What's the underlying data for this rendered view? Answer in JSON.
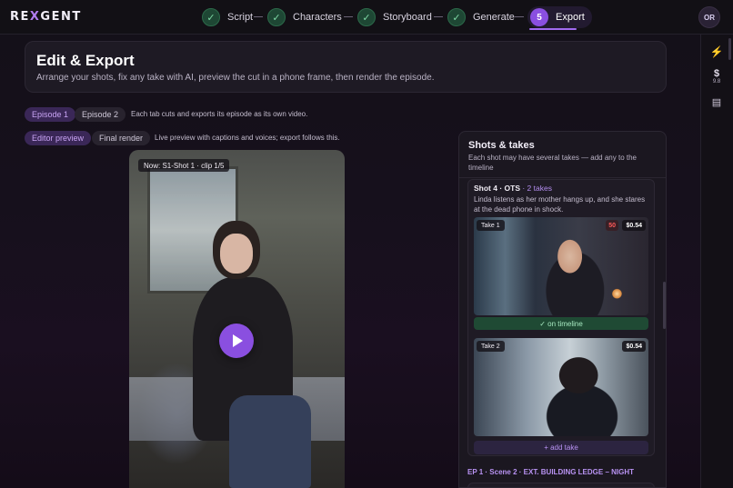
{
  "app": {
    "logo_main": "RE",
    "logo_x": "X",
    "logo_rest": "GENT"
  },
  "steps": [
    {
      "label": "Script",
      "done": true
    },
    {
      "label": "Characters",
      "done": true
    },
    {
      "label": "Storyboard",
      "done": true
    },
    {
      "label": "Generate",
      "done": true
    },
    {
      "label": "Export",
      "number": "5",
      "active": true
    }
  ],
  "user": {
    "initials": "OR"
  },
  "rail": {
    "dollar": "$",
    "credits": "9.8"
  },
  "header": {
    "title": "Edit & Export",
    "subtitle": "Arrange your shots, fix any take with AI, preview the cut in a phone frame, then render the episode."
  },
  "episodes": {
    "tabs": [
      "Episode 1",
      "Episode 2"
    ],
    "active": "Episode 1",
    "hint": "Each tab cuts and exports its episode as its own video."
  },
  "modes": {
    "tabs": [
      "Editor preview",
      "Final render"
    ],
    "active": "Editor preview",
    "hint": "Live preview with captions and voices; export follows this."
  },
  "preview": {
    "now_label": "Now: S1-Shot 1 · clip 1/5"
  },
  "panel": {
    "title": "Shots & takes",
    "subtitle": "Each shot may have several takes — add any to the timeline",
    "shot": {
      "title": "Shot 4 · OTS",
      "takes_count": " · 2 takes",
      "description": "Linda listens as her mother hangs up, and she stares at the dead phone in shock.",
      "takes": [
        {
          "label": "Take 1",
          "price": "$0.54",
          "marker": "50"
        },
        {
          "label": "Take 2",
          "price": "$0.54"
        }
      ],
      "on_timeline_label": "✓ on timeline",
      "add_take_label": "+ add take"
    },
    "next_scene": "EP 1 · Scene 2 · EXT. BUILDING LEDGE – NIGHT"
  }
}
